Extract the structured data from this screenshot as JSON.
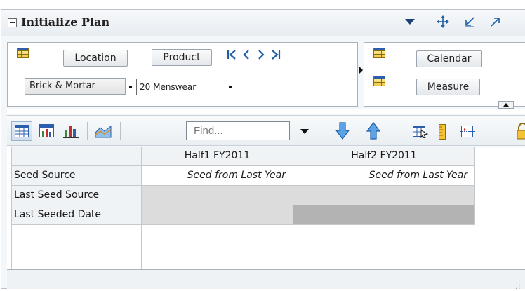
{
  "panel": {
    "title": "Initialize Plan",
    "header_icons": [
      "dropdown-caret-icon",
      "move-icon",
      "minimize-icon",
      "maximize-icon"
    ]
  },
  "pivot": {
    "row_dimensions": [
      "Location",
      "Product"
    ],
    "column_dimensions": [
      "Calendar",
      "Measure"
    ],
    "nav_icons": [
      "first-icon",
      "previous-icon",
      "next-icon",
      "last-icon"
    ],
    "members": {
      "location": "Brick & Mortar",
      "product": "20 Menswear"
    }
  },
  "toolbar": {
    "find_placeholder": "Find...",
    "icons": [
      "table-view-icon",
      "chart-table-icon",
      "bar-chart-icon",
      "area-chart-icon",
      "find-dropdown-icon",
      "find-next-icon",
      "find-previous-icon",
      "export-icon",
      "ruler-icon",
      "split-icon",
      "lock-icon"
    ]
  },
  "table": {
    "columns": [
      "Half1 FY2011",
      "Half2 FY2011"
    ],
    "rows": [
      {
        "label": "Seed Source",
        "values": [
          "Seed from Last Year",
          "Seed from Last Year"
        ]
      },
      {
        "label": "Last Seed Source",
        "values": [
          "",
          ""
        ]
      },
      {
        "label": "Last Seeded Date",
        "values": [
          "",
          ""
        ]
      }
    ]
  },
  "colors": {
    "accent": "#1d5fa8",
    "header_bg": "#f0f3f6",
    "readonly_cell": "#dcdcdc",
    "locked_cell": "#b3b3b3"
  }
}
